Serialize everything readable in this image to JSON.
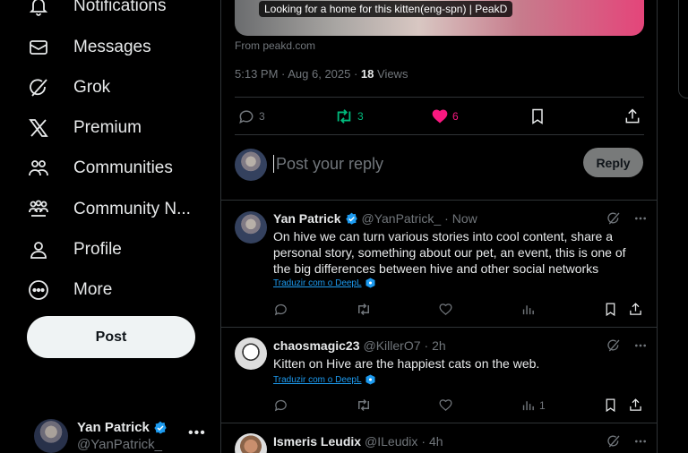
{
  "nav": {
    "items": [
      {
        "label": "Notifications",
        "icon": "bell-icon"
      },
      {
        "label": "Messages",
        "icon": "envelope-icon"
      },
      {
        "label": "Grok",
        "icon": "grok-icon"
      },
      {
        "label": "Premium",
        "icon": "x-logo-icon"
      },
      {
        "label": "Communities",
        "icon": "communities-icon"
      },
      {
        "label": "Community N...",
        "icon": "community-notes-icon"
      },
      {
        "label": "Profile",
        "icon": "person-icon"
      },
      {
        "label": "More",
        "icon": "more-circle-icon"
      }
    ],
    "post_label": "Post"
  },
  "account": {
    "name": "Yan Patrick",
    "handle": "@YanPatrick_",
    "menu": "•••"
  },
  "post": {
    "card_caption": "Looking for a home for this kitten(eng-spn) | PeakD",
    "from": "From peakd.com",
    "time": "5:13 PM · Aug 6, 2025 · ",
    "views_count": "18",
    "views_label": " Views",
    "replies": "3",
    "reposts": "3",
    "likes": "6",
    "colors": {
      "repost": "#00ba7c",
      "like": "#f91880",
      "accent": "#1d9bf0"
    }
  },
  "reply_box": {
    "placeholder": "Post your reply",
    "button": "Reply"
  },
  "tweets": [
    {
      "name": "Yan Patrick",
      "handle": "@YanPatrick_",
      "time": "· Now",
      "verified": true,
      "text": "On hive we can turn various stories into cool content, share a personal story, something about our pet, an event, this is one of the big differences between hive and other social networks",
      "translate": "Traduzir com o DeepL",
      "views": ""
    },
    {
      "name": "chaosmagic23",
      "handle": "@KillerO7",
      "time": "· 2h",
      "verified": false,
      "text": "Kitten on Hive are the happiest cats on the web.",
      "translate": "Traduzir com o DeepL",
      "views": "1"
    },
    {
      "name": "Ismeris Leudix",
      "handle": "@ILeudix",
      "time": "· 4h",
      "verified": false
    }
  ]
}
